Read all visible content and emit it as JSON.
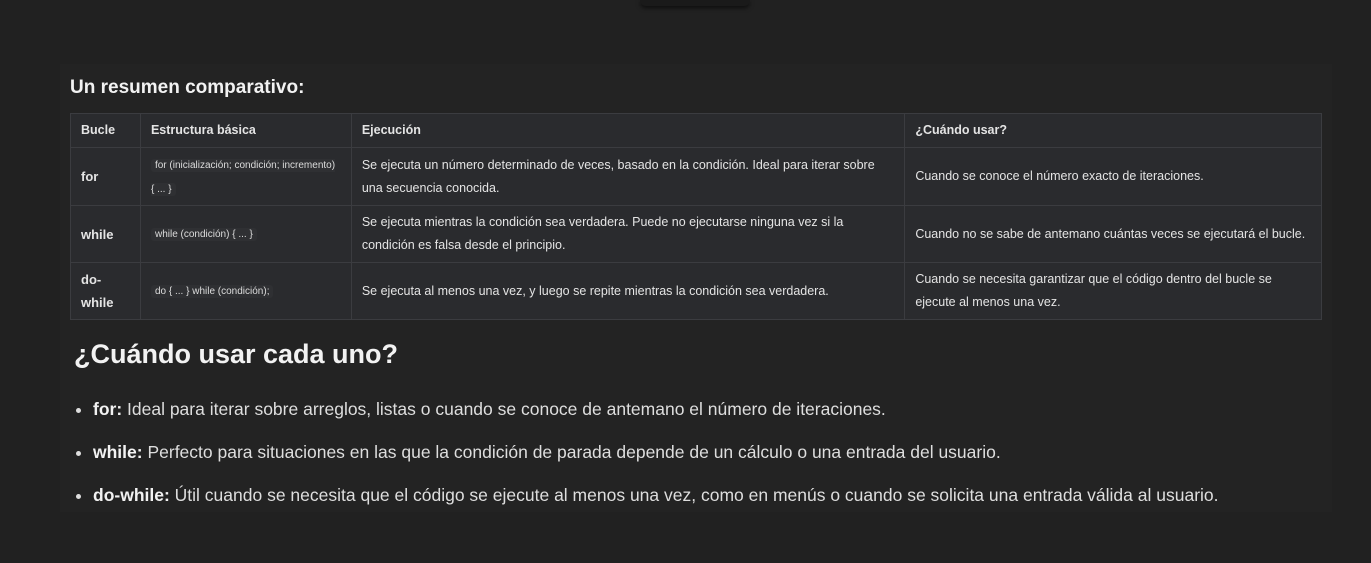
{
  "summary": {
    "heading": "Un resumen comparativo:"
  },
  "table": {
    "headers": [
      "Bucle",
      "Estructura básica",
      "Ejecución",
      "¿Cuándo usar?"
    ],
    "rows": [
      {
        "loop": "for",
        "structure": "for (inicialización; condición; incremento) { ... }",
        "execution": "Se ejecuta un número determinado de veces, basado en la condición. Ideal para iterar sobre una secuencia conocida.",
        "when": "Cuando se conoce el número exacto de iteraciones."
      },
      {
        "loop": "while",
        "structure": "while (condición) { ... }",
        "execution": "Se ejecuta mientras la condición sea verdadera. Puede no ejecutarse ninguna vez si la condición es falsa desde el principio.",
        "when": "Cuando no se sabe de antemano cuántas veces se ejecutará el bucle."
      },
      {
        "loop": "do-while",
        "structure": "do { ... } while (condición);",
        "execution": "Se ejecuta al menos una vez, y luego se repite mientras la condición sea verdadera.",
        "when": "Cuando se necesita garantizar que el código dentro del bucle se ejecute al menos una vez."
      }
    ]
  },
  "usage": {
    "title": "¿Cuándo usar cada uno?",
    "items": [
      {
        "term": "for:",
        "text": " Ideal para iterar sobre arreglos, listas o cuando se conoce de antemano el número de iteraciones."
      },
      {
        "term": "while:",
        "text": " Perfecto para situaciones en las que la condición de parada depende de un cálculo o una entrada del usuario."
      },
      {
        "term": "do-while:",
        "text": " Útil cuando se necesita que el código se ejecute al menos una vez, como en menús o cuando se solicita una entrada válida al usuario."
      }
    ]
  }
}
